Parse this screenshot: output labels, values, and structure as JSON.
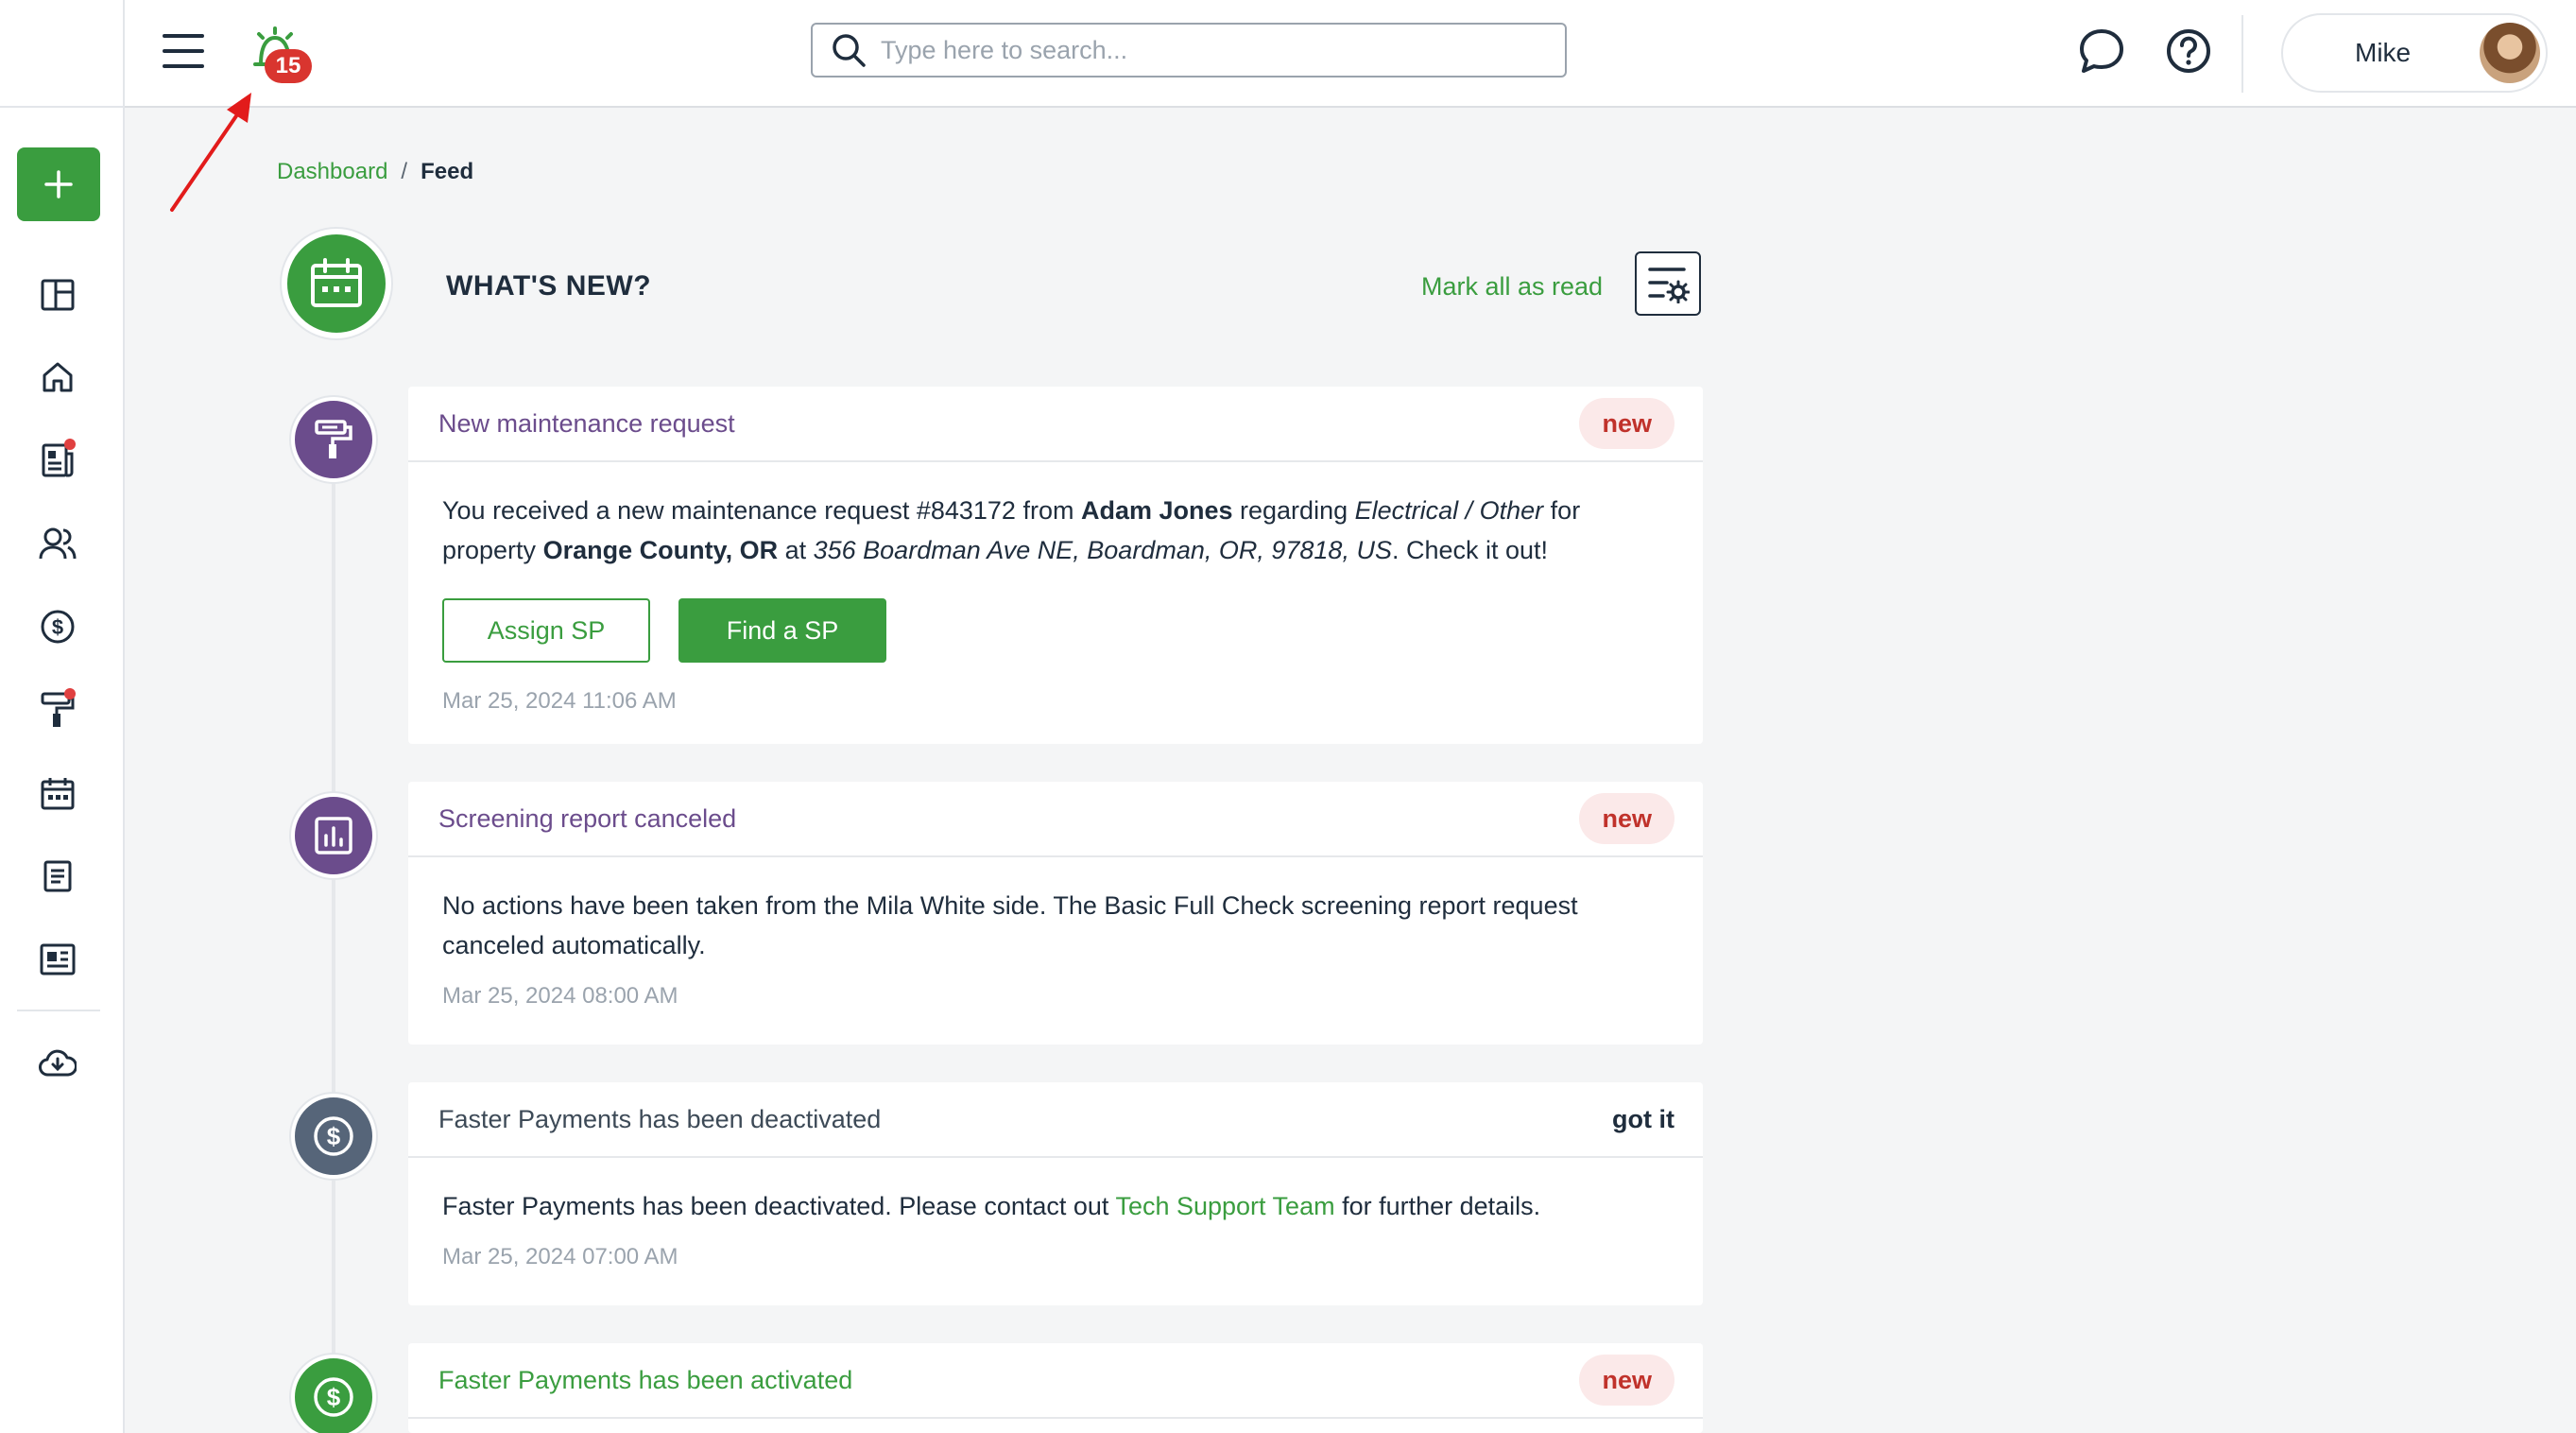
{
  "colors": {
    "accent_green": "#3a9d3f",
    "maintenance_purple": "#6b4c8c",
    "slate_icon": "#566579",
    "badge_red": "#d9352f",
    "new_badge_bg": "#fbe9e9"
  },
  "topbar": {
    "notification_count": "15",
    "search_placeholder": "Type here to search...",
    "user_name": "Mike"
  },
  "breadcrumb": {
    "parent": "Dashboard",
    "separator": "/",
    "current": "Feed"
  },
  "header": {
    "title": "WHAT'S NEW?",
    "mark_all_read": "Mark all as read"
  },
  "sidebar": {
    "icons": [
      "plus-icon",
      "dashboard-grid-icon",
      "home-icon",
      "reports-icon",
      "people-icon",
      "dollar-icon",
      "paint-roller-icon",
      "calendar-icon",
      "document-icon",
      "newspaper-icon",
      "cloud-download-icon"
    ]
  },
  "feed": [
    {
      "title": "New maintenance request",
      "status": "new",
      "body": {
        "p1": "You received a new maintenance request #843172 from ",
        "name": "Adam Jones",
        "p2": " regarding ",
        "category": "Electrical / Other",
        "p3": " for property ",
        "property": "Orange County, OR",
        "p4": " at ",
        "address": "356 Boardman Ave NE, Boardman, OR, 97818, US",
        "p5": ". Check it out!"
      },
      "actions": {
        "assign": "Assign SP",
        "find": "Find a SP"
      },
      "timestamp": "Mar 25, 2024 11:06 AM"
    },
    {
      "title": "Screening report canceled",
      "status": "new",
      "body": "No actions have been taken from the Mila White side. The Basic Full Check screening report request canceled automatically.",
      "timestamp": "Mar 25, 2024 08:00 AM"
    },
    {
      "title": "Faster Payments has been deactivated",
      "status": "got it",
      "body": {
        "p1": "Faster Payments has been deactivated. Please contact out ",
        "link": "Tech Support Team",
        "p2": " for further details."
      },
      "timestamp": "Mar 25, 2024 07:00 AM"
    },
    {
      "title": "Faster Payments has been activated",
      "status": "new"
    }
  ]
}
